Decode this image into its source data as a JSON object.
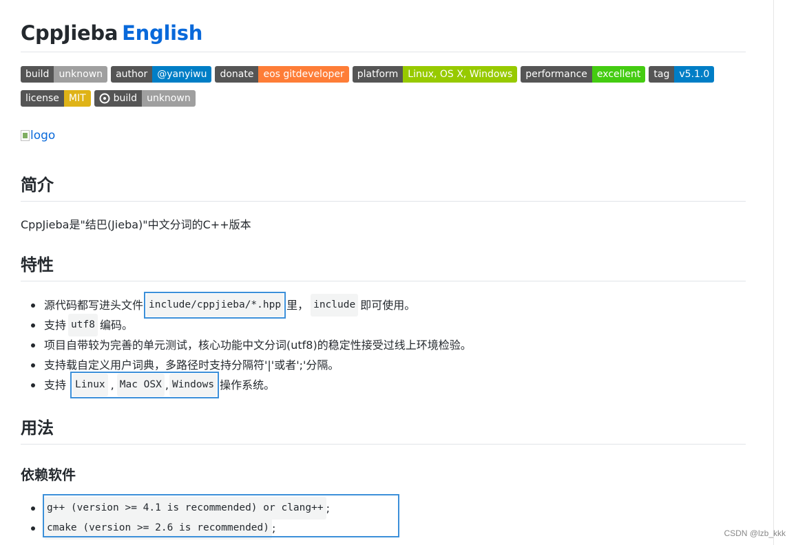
{
  "title": {
    "main": "CppJieba",
    "lang_link": "English"
  },
  "badges_row1": [
    {
      "label": "build",
      "value": "unknown",
      "color": "grey"
    },
    {
      "label": "author",
      "value": "@yanyiwu",
      "color": "blue"
    },
    {
      "label": "donate",
      "value": "eos gitdeveloper",
      "color": "orange"
    },
    {
      "label": "platform",
      "value": "Linux, OS X, Windows",
      "color": "yellowgreen"
    },
    {
      "label": "performance",
      "value": "excellent",
      "color": "green"
    },
    {
      "label": "tag",
      "value": "v5.1.0",
      "color": "blue"
    }
  ],
  "badges_row2": [
    {
      "label": "license",
      "value": "MIT",
      "color": "yellow"
    },
    {
      "label": "build",
      "value": "unknown",
      "color": "grey",
      "icon": "github-actions-icon"
    }
  ],
  "logo": {
    "alt": "logo"
  },
  "sections": {
    "intro": {
      "heading": "简介",
      "text": "CppJieba是\"结巴(Jieba)\"中文分词的C++版本"
    },
    "features": {
      "heading": "特性",
      "items": {
        "i1": {
          "a": "源代码都写进头文件",
          "code1": "include/cppjieba/*.hpp",
          "b": "里，",
          "code2": "include",
          "c": "即可使用。"
        },
        "i2": {
          "a": "支持",
          "code1": "utf8",
          "b": "编码。"
        },
        "i3": {
          "a": "项目自带较为完善的单元测试，核心功能中文分词(utf8)的稳定性接受过线上环境检验。"
        },
        "i4": {
          "a": "支持载自定义用户词典，多路径时支持分隔符'|'或者';'分隔。"
        },
        "i5": {
          "a": "支持",
          "code1": "Linux",
          "sep1": ",",
          "code2": "Mac OSX",
          "sep2": ",",
          "code3": "Windows",
          "b": "操作系统。"
        }
      }
    },
    "usage": {
      "heading": "用法",
      "deps": {
        "heading": "依赖软件",
        "items": [
          {
            "code": "g++ (version >= 4.1 is recommended) or clang++",
            "tail": ";"
          },
          {
            "code": "cmake (version >= 2.6 is recommended)",
            "tail": ";"
          }
        ]
      }
    }
  },
  "watermark": "CSDN @lzb_kkk",
  "colors": {
    "link": "#0969da",
    "highlight_box": "#3b8fd9",
    "badge_label": "#555555"
  }
}
